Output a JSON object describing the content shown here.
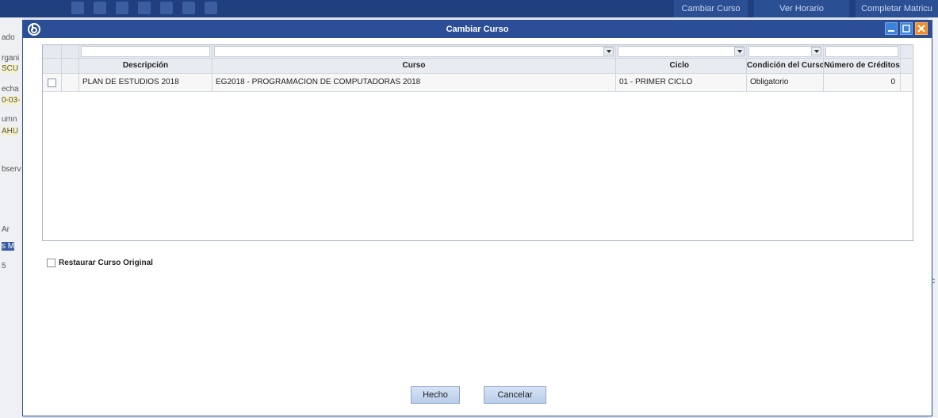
{
  "background": {
    "tabs": [
      "Cambiar Curso",
      "Ver Horario",
      "Completar Matricu"
    ],
    "left_fragments": [
      "ado",
      "rgani",
      "SCU",
      "echa",
      "0-03-",
      "umn",
      "AHU",
      "bserv",
      "Ar",
      "s M",
      "5"
    ],
    "right_fragment": "ic"
  },
  "dialog": {
    "title": "Cambiar Curso",
    "columns": [
      "Descripción",
      "Curso",
      "Ciclo",
      "Condición del Curso",
      "Número de Créditos"
    ],
    "rows": [
      {
        "descripcion": "PLAN DE ESTUDIOS 2018",
        "curso": "EG2018 - PROGRAMACION DE COMPUTADORAS 2018",
        "ciclo": "01 - PRIMER CICLO",
        "condicion": "Obligatorio",
        "creditos": "0"
      }
    ],
    "restore_label": "Restaurar Curso Original",
    "ok_label": "Hecho",
    "cancel_label": "Cancelar"
  },
  "colors": {
    "titlebar": "#2c4e96",
    "accent": "#3d83d9",
    "close": "#f08c2a"
  }
}
